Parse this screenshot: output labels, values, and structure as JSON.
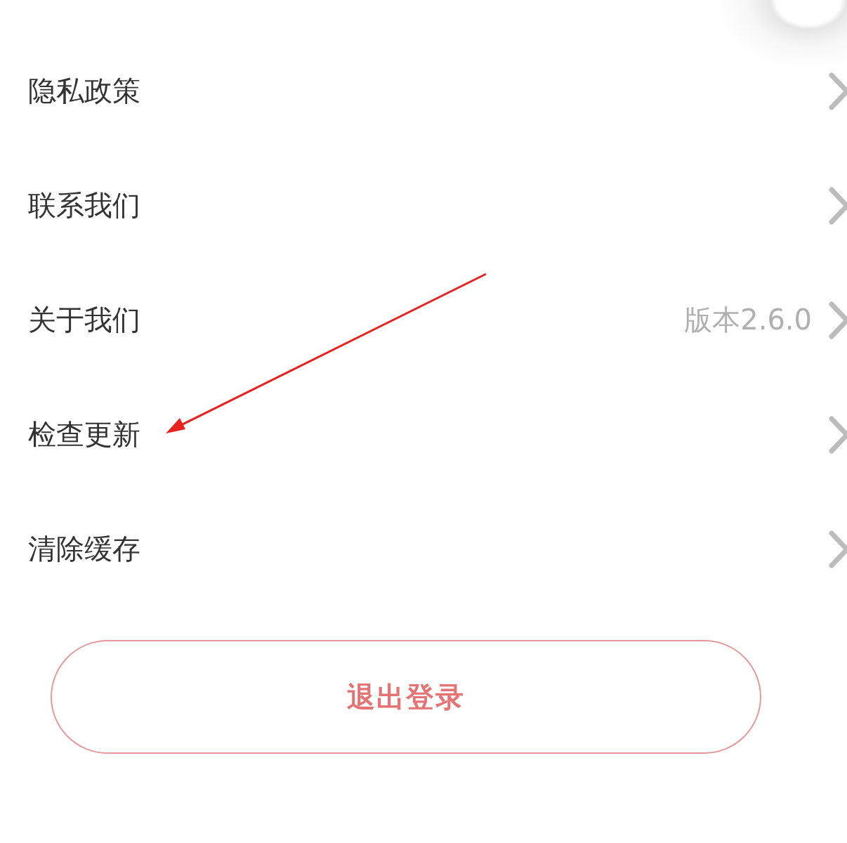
{
  "menu_items": [
    {
      "label": "隐私政策"
    },
    {
      "label": "联系我们"
    },
    {
      "label": "关于我们",
      "value": "版本2.6.0"
    },
    {
      "label": "检查更新"
    },
    {
      "label": "清除缓存"
    }
  ],
  "logout_button": {
    "label": "退出登录"
  }
}
